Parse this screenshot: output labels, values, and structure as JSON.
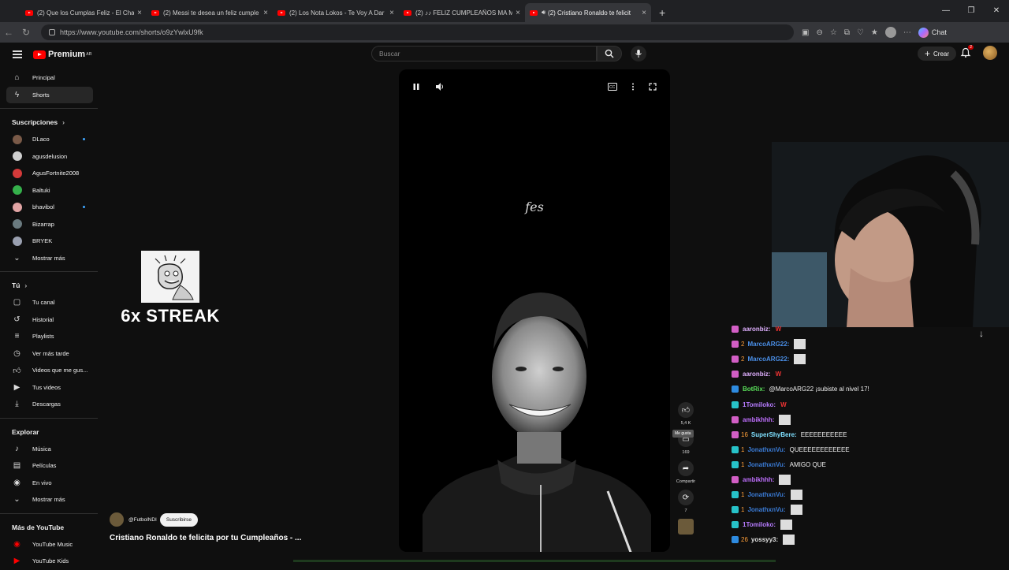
{
  "browser": {
    "tabs": [
      {
        "title": "(2) Que los Cumplas Feliz - El Cha"
      },
      {
        "title": "(2) Messi te desea un feliz cumple"
      },
      {
        "title": "(2) Los Nota Lokos - Te Voy A Dar"
      },
      {
        "title": "(2) ♪♪ FELIZ CUMPLEAÑOS MA M"
      },
      {
        "title": "(2) Cristiano Ronaldo te felicit"
      }
    ],
    "new_tab": "+",
    "url": "https://www.youtube.com/shorts/o9zYwlxU9fk",
    "chat_label": "Chat"
  },
  "youtube": {
    "logo": "Premium",
    "logo_sup": "AR",
    "search_placeholder": "Buscar",
    "create_label": "Crear",
    "notif_count": "2",
    "sidebar": {
      "main": [
        {
          "label": "Principal",
          "icon": "home-icon"
        },
        {
          "label": "Shorts",
          "icon": "shorts-icon"
        }
      ],
      "subs_title": "Suscripciones",
      "subs": [
        {
          "label": "DLaco",
          "color": "#7a5a48",
          "dot": true
        },
        {
          "label": "agusdelusion",
          "color": "#cfcfcf",
          "dot": false
        },
        {
          "label": "AgusFortnite2008",
          "color": "#d43a3a",
          "dot": false
        },
        {
          "label": "Baltuki",
          "color": "#35b04b",
          "dot": false
        },
        {
          "label": "bhavibol",
          "color": "#e2a5a5",
          "dot": true
        },
        {
          "label": "Bizarrap",
          "color": "#6a7a7f",
          "dot": false
        },
        {
          "label": "BRYEK",
          "color": "#9aa0b0",
          "dot": false
        }
      ],
      "show_more": "Mostrar más",
      "you_title": "Tú",
      "you": [
        {
          "label": "Tu canal",
          "icon": "channel-icon"
        },
        {
          "label": "Historial",
          "icon": "history-icon"
        },
        {
          "label": "Playlists",
          "icon": "playlists-icon"
        },
        {
          "label": "Ver más tarde",
          "icon": "watch-later-icon"
        },
        {
          "label": "Videos que me gus...",
          "icon": "liked-icon"
        },
        {
          "label": "Tus videos",
          "icon": "your-videos-icon"
        },
        {
          "label": "Descargas",
          "icon": "downloads-icon"
        }
      ],
      "explore_title": "Explorar",
      "explore": [
        {
          "label": "Música",
          "icon": "music-icon"
        },
        {
          "label": "Películas",
          "icon": "movies-icon"
        },
        {
          "label": "En vivo",
          "icon": "live-icon"
        }
      ],
      "explore_more": "Mostrar más",
      "more_title": "Más de YouTube",
      "more": [
        {
          "label": "YouTube Music",
          "icon": "youtube-music-icon"
        },
        {
          "label": "YouTube Kids",
          "icon": "youtube-kids-icon"
        }
      ]
    },
    "streak_text": "6x STREAK",
    "video": {
      "overlay_text": "feѕ",
      "like_count": "5,4 K",
      "like_tooltip": "Me gusta",
      "comments_count": "169",
      "share_label": "Compartir",
      "remix_count": "7",
      "channel": "@FutbolNDI",
      "subscribe_label": "Suscribirse",
      "title": "Cristiano Ronaldo te felicita por tu Cumpleaños - ..."
    }
  },
  "chat": [
    {
      "user": "aaronbiz:",
      "color": "#e0b0ff",
      "text": "",
      "emote": "w",
      "badge": "#d25ec5",
      "extra": ""
    },
    {
      "user": "MarcoARG22:",
      "color": "#4a8fe8",
      "text": "",
      "emote": "img",
      "badge": "#d25ec5",
      "extra": "2"
    },
    {
      "user": "MarcoARG22:",
      "color": "#4a8fe8",
      "text": "",
      "emote": "img",
      "badge": "#d25ec5",
      "extra": "2"
    },
    {
      "user": "aaronbiz:",
      "color": "#e0b0ff",
      "text": "",
      "emote": "w",
      "badge": "#d25ec5",
      "extra": ""
    },
    {
      "user": "BotRix:",
      "color": "#5ae05a",
      "text": "@MarcoARG22 ¡subiste al nivel 17!",
      "emote": "",
      "badge": "#2e8be0",
      "extra": ""
    },
    {
      "user": "1Tomiloko:",
      "color": "#b77cff",
      "text": "",
      "emote": "w",
      "badge": "#27c2c8",
      "extra": ""
    },
    {
      "user": "ambikhhh:",
      "color": "#c070ff",
      "text": "",
      "emote": "img",
      "badge": "#d25ec5",
      "extra": ""
    },
    {
      "user": "SuperShyBere:",
      "color": "#7fe0ff",
      "text": "EEEEEEEEEEE",
      "emote": "",
      "badge": "#d25ec5",
      "extra": "16"
    },
    {
      "user": "JonathxnVu:",
      "color": "#3a7bd5",
      "text": "QUEEEEEEEEEEEE",
      "emote": "",
      "badge": "#27c2c8",
      "extra": "1"
    },
    {
      "user": "JonathxnVu:",
      "color": "#3a7bd5",
      "text": "AMIGO QUE",
      "emote": "",
      "badge": "#27c2c8",
      "extra": "1"
    },
    {
      "user": "ambikhhh:",
      "color": "#c070ff",
      "text": "",
      "emote": "img",
      "badge": "#d25ec5",
      "extra": ""
    },
    {
      "user": "JonathxnVu:",
      "color": "#3a7bd5",
      "text": "",
      "emote": "img",
      "badge": "#27c2c8",
      "extra": "1"
    },
    {
      "user": "JonathxnVu:",
      "color": "#3a7bd5",
      "text": "",
      "emote": "img",
      "badge": "#27c2c8",
      "extra": "1"
    },
    {
      "user": "1Tomiloko:",
      "color": "#b77cff",
      "text": "",
      "emote": "img",
      "badge": "#27c2c8",
      "extra": ""
    },
    {
      "user": "yossyy3:",
      "color": "#e0e0e0",
      "text": "",
      "emote": "img",
      "badge": "#2e8be0",
      "extra": "26"
    }
  ]
}
